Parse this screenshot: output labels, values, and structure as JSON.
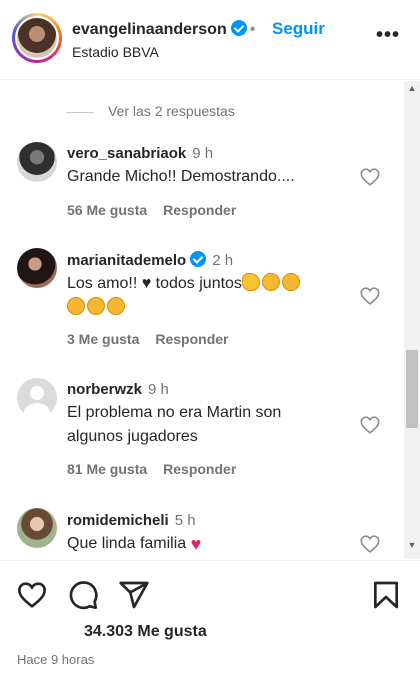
{
  "header": {
    "username": "evangelinaanderson",
    "separator": "•",
    "follow_label": "Seguir",
    "location": "Estadio BBVA",
    "more_icon": "more-options-icon",
    "more_glyph": "•••"
  },
  "thread": {
    "view_replies": "Ver las 2 respuestas"
  },
  "comments": [
    {
      "username": "vero_sanabriaok",
      "time": "9 h",
      "text": "Grande Micho!! Demostrando....",
      "likes": "56 Me gusta",
      "reply": "Responder"
    },
    {
      "username": "marianitademelo",
      "time": "2 h",
      "text_before": "Los amo!! ",
      "heart_glyph": "♥",
      "text_after": " todos juntos",
      "likes": "3 Me gusta",
      "reply": "Responder",
      "verified": true
    },
    {
      "username": "norberwzk",
      "time": "9 h",
      "text": "El problema no era Martin son algunos jugadores",
      "likes": "81 Me gusta",
      "reply": "Responder"
    },
    {
      "username": "romidemicheli",
      "time": "5 h",
      "text": "Que linda familia ",
      "heart_glyph": "♥"
    }
  ],
  "footer": {
    "likes_count": "34.303 Me gusta",
    "time_ago": "Hace 9 horas"
  },
  "scrollbar": {
    "up_glyph": "▲",
    "down_glyph": "▼"
  },
  "colors": {
    "accent": "#0095f6",
    "text": "#262626",
    "muted": "#737373",
    "heart_red": "#e0245e"
  }
}
